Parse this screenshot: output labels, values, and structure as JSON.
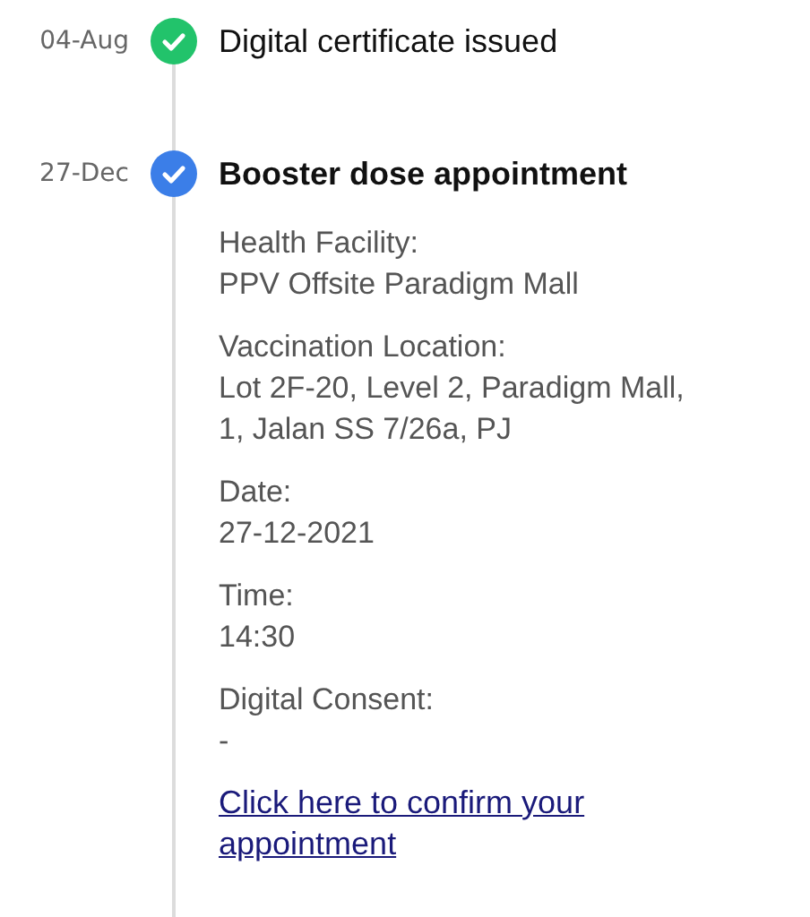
{
  "timeline": [
    {
      "date": "04-Aug",
      "title": "Digital certificate issued",
      "color": "#22c36b",
      "active": false
    },
    {
      "date": "27-Dec",
      "title": "Booster dose appointment",
      "color": "#3b7ee8",
      "active": true,
      "details": [
        {
          "label": "Health Facility:",
          "lines": [
            "PPV Offsite Paradigm Mall"
          ]
        },
        {
          "label": "Vaccination Location:",
          "lines": [
            "Lot 2F-20, Level 2, Paradigm Mall,",
            "1, Jalan SS 7/26a, PJ"
          ]
        },
        {
          "label": "Date:",
          "lines": [
            "27-12-2021"
          ]
        },
        {
          "label": "Time:",
          "lines": [
            "14:30"
          ]
        },
        {
          "label": "Digital Consent:",
          "lines": [
            "-"
          ]
        }
      ],
      "link": "Click here to confirm your appointment"
    }
  ]
}
